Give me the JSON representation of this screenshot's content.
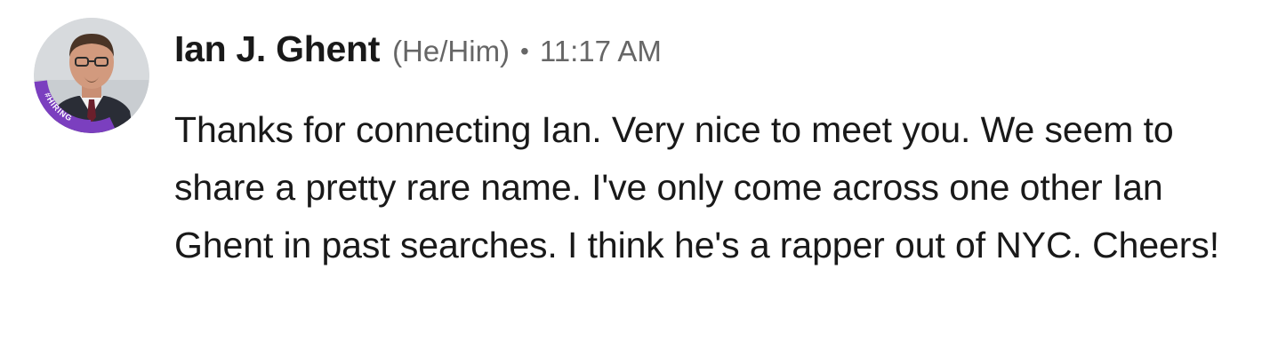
{
  "message": {
    "sender": {
      "name": "Ian J. Ghent",
      "pronouns": "(He/Him)",
      "avatar_badge": "#HIRING",
      "badge_color": "#7B3FBF"
    },
    "separator": "•",
    "timestamp": "11:17 AM",
    "body": "Thanks for connecting Ian. Very nice to meet you. We seem to share a pretty rare name. I've only come across one other Ian Ghent in past searches. I think he's a rapper out of NYC. Cheers!"
  }
}
